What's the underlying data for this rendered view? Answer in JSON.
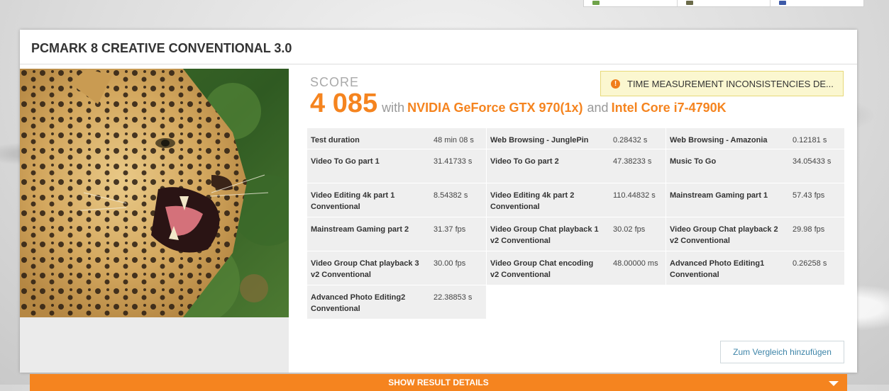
{
  "result": {
    "title": "PCMARK 8 CREATIVE CONVENTIONAL 3.0",
    "score_label": "SCORE",
    "score_value": "4 085",
    "with_text": "with",
    "gpu": "NVIDIA GeForce GTX 970(1x)",
    "and_text": "and",
    "cpu": "Intel Core i7-4790K",
    "warning": "TIME MEASUREMENT INCONSISTENCIES DE...",
    "compare_button": "Zum Vergleich hinzufügen",
    "show_details": "SHOW RESULT DETAILS"
  },
  "metrics": [
    {
      "name": "Test duration",
      "value": "48 min 08 s"
    },
    {
      "name": "Web Browsing - JunglePin",
      "value": "0.28432 s"
    },
    {
      "name": "Web Browsing - Amazonia",
      "value": "0.12181 s"
    },
    {
      "name": "Video To Go part 1",
      "value": "31.41733 s"
    },
    {
      "name": "Video To Go part 2",
      "value": "47.38233 s"
    },
    {
      "name": "Music To Go",
      "value": "34.05433 s"
    },
    {
      "name": "Video Editing 4k part 1 Conventional",
      "value": "8.54382 s"
    },
    {
      "name": "Video Editing 4k part 2 Conventional",
      "value": "110.44832 s"
    },
    {
      "name": "Mainstream Gaming part 1",
      "value": "57.43 fps"
    },
    {
      "name": "Mainstream Gaming part 2",
      "value": "31.37 fps"
    },
    {
      "name": "Video Group Chat playback 1 v2 Conventional",
      "value": "30.02 fps"
    },
    {
      "name": "Video Group Chat playback 2 v2 Conventional",
      "value": "29.98 fps"
    },
    {
      "name": "Video Group Chat playback 3 v2 Conventional",
      "value": "30.00 fps"
    },
    {
      "name": "Video Group Chat encoding v2 Conventional",
      "value": "48.00000 ms"
    },
    {
      "name": "Advanced Photo Editing1 Conventional",
      "value": "0.26258 s"
    },
    {
      "name": "Advanced Photo Editing2 Conventional",
      "value": "22.38853 s"
    }
  ],
  "colors": {
    "accent": "#f5841f",
    "warning_bg": "#fbf7d0",
    "link": "#3d84a8"
  },
  "icons": {
    "warning": "warning-icon",
    "dropdown": "triangle-down-icon"
  }
}
